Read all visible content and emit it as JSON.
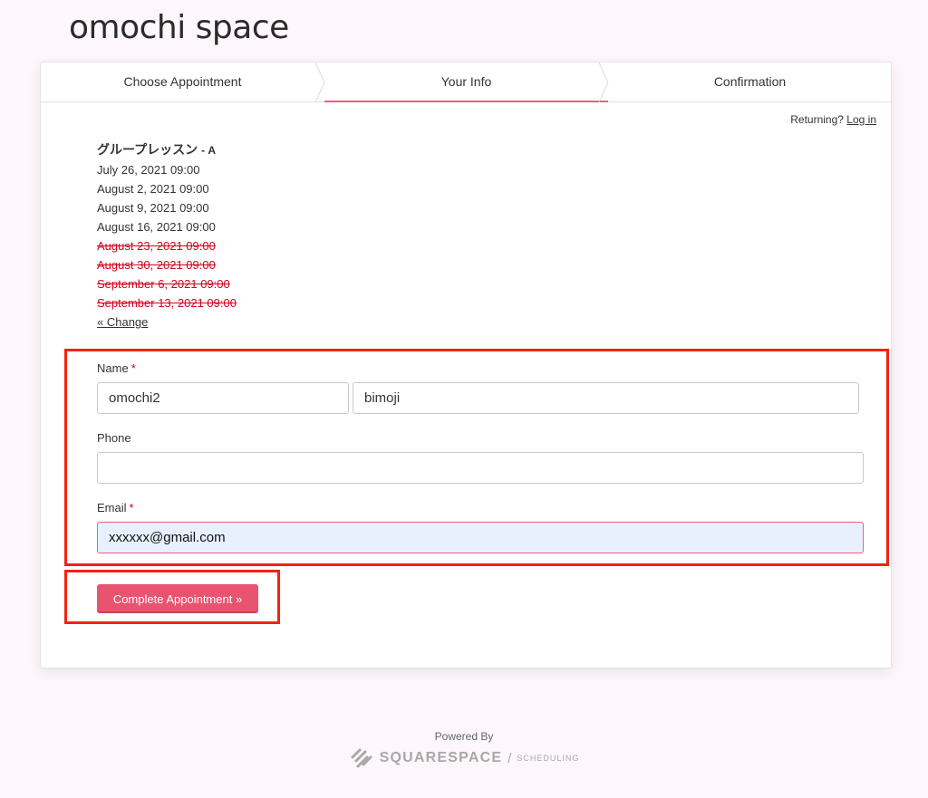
{
  "site": {
    "title": "omochi space"
  },
  "steps": [
    {
      "label": "Choose Appointment"
    },
    {
      "label": "Your Info"
    },
    {
      "label": "Confirmation"
    }
  ],
  "returning": {
    "text": "Returning?",
    "link": "Log in"
  },
  "appointment": {
    "title": "グループレッスン",
    "subtitle": "- A",
    "dates": [
      {
        "text": "July 26, 2021 09:00"
      },
      {
        "text": "August 2, 2021 09:00"
      },
      {
        "text": "August 9, 2021 09:00"
      },
      {
        "text": "August 16, 2021 09:00"
      }
    ],
    "struck_dates": [
      {
        "text": "August 23, 2021 09:00"
      },
      {
        "text": "August 30, 2021 09:00"
      },
      {
        "text": "September 6, 2021 09:00"
      },
      {
        "text": "September 13, 2021 09:00"
      }
    ],
    "change_link": "« Change"
  },
  "form": {
    "name_label": "Name",
    "required_mark": "*",
    "first_name": "omochi2",
    "last_name": "bimoji",
    "phone_label": "Phone",
    "phone_value": "",
    "email_label": "Email",
    "email_value": "xxxxxx@gmail.com",
    "submit_label": "Complete Appointment »"
  },
  "footer": {
    "powered_by": "Powered By",
    "brand": "SQUARESPACE",
    "separator": "/",
    "product": "SCHEDULING"
  },
  "colors": {
    "accent": "#e8546f",
    "struck_text": "#d0021b",
    "highlight_border": "#f02211",
    "page_bg": "#fdf6fa"
  }
}
